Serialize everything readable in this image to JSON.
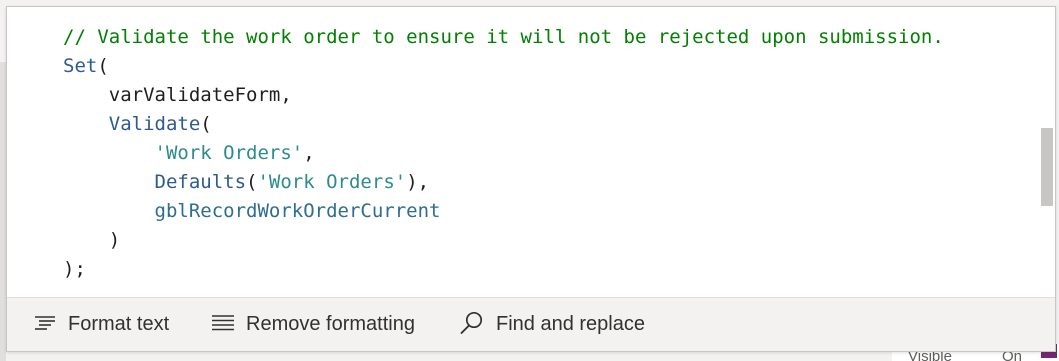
{
  "code": {
    "lines": [
      {
        "indent": "",
        "parts": [
          {
            "t": "// Validate the work order to ensure it will not be rejected upon submission.",
            "k": "comment"
          }
        ]
      },
      {
        "indent": "",
        "parts": [
          {
            "t": "Set",
            "k": "func"
          },
          {
            "t": "(",
            "k": "plain"
          }
        ]
      },
      {
        "indent": "    ",
        "parts": [
          {
            "t": "varValidateForm,",
            "k": "plain"
          }
        ]
      },
      {
        "indent": "    ",
        "parts": [
          {
            "t": "Validate",
            "k": "func"
          },
          {
            "t": "(",
            "k": "plain"
          }
        ]
      },
      {
        "indent": "        ",
        "parts": [
          {
            "t": "'Work Orders'",
            "k": "string"
          },
          {
            "t": ",",
            "k": "plain"
          }
        ]
      },
      {
        "indent": "        ",
        "parts": [
          {
            "t": "Defaults",
            "k": "func"
          },
          {
            "t": "(",
            "k": "plain"
          },
          {
            "t": "'Work Orders'",
            "k": "string"
          },
          {
            "t": "),",
            "k": "plain"
          }
        ]
      },
      {
        "indent": "        ",
        "parts": [
          {
            "t": "gblRecordWorkOrderCurrent",
            "k": "ident"
          }
        ]
      },
      {
        "indent": "    ",
        "parts": [
          {
            "t": ")",
            "k": "plain"
          }
        ]
      },
      {
        "indent": "",
        "parts": [
          {
            "t": ");",
            "k": "plain"
          }
        ]
      }
    ]
  },
  "toolbar": {
    "format_text": {
      "label": "Format text",
      "icon": "format-text-icon"
    },
    "remove_formatting": {
      "label": "Remove formatting",
      "icon": "remove-formatting-icon"
    },
    "find_replace": {
      "label": "Find and replace",
      "icon": "search-icon"
    }
  },
  "background": {
    "property_label": "Visible",
    "property_value": "On"
  },
  "colors": {
    "comment": "#008000",
    "function": "#2e5b8f",
    "string": "#2c8c8c",
    "identifier": "#2e6e8e",
    "accent": "#742774"
  }
}
